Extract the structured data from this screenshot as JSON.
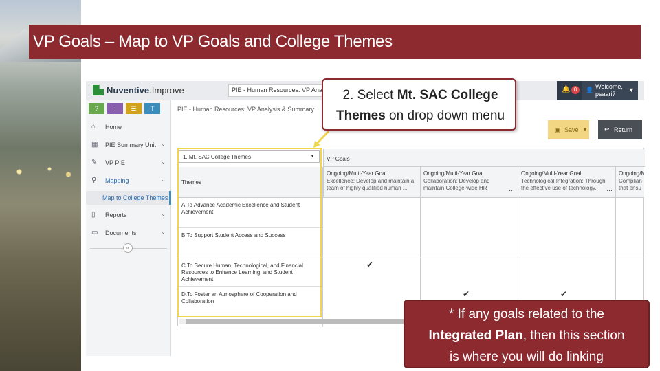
{
  "slide": {
    "title": "VP Goals – Map to VP Goals and College Themes"
  },
  "app": {
    "logo_brand": "Nuventive",
    "logo_suffix": ".Improve",
    "unit_select": "PIE - Human Resources: VP Analy",
    "notification_count": "0",
    "user_welcome": "Welcome,",
    "user_name": "psaari7",
    "breadcrumb": "PIE - Human Resources: VP Analysis & Summary",
    "save_label": "Save",
    "return_label": "Return"
  },
  "sidebar": {
    "items": [
      {
        "label": "Home",
        "icon": "home-icon"
      },
      {
        "label": "PIE Summary Unit",
        "icon": "building-icon"
      },
      {
        "label": "VP PIE",
        "icon": "pencil-icon"
      },
      {
        "label": "Mapping",
        "icon": "sitemap-icon"
      },
      {
        "label": "Reports",
        "icon": "book-icon"
      },
      {
        "label": "Documents",
        "icon": "folder-icon"
      }
    ],
    "subitem": "Map to College Themes"
  },
  "grid": {
    "theme_select": "1. Mt. SAC College Themes",
    "vp_goals_header": "VP Goals",
    "themes_header": "Themes",
    "goals": [
      {
        "title": "Ongoing/Multi-Year Goal",
        "line1": "Excellence: Develop and maintain a",
        "line2": "team of highly qualified human ..."
      },
      {
        "title": "Ongoing/Multi-Year Goal",
        "line1": "Collaboration: Develop and",
        "line2": "maintain College-wide HR"
      },
      {
        "title": "Ongoing/Multi-Year Goal",
        "line1": "Technological Integration: Through",
        "line2": "the effective use of technology,"
      },
      {
        "title": "Ongoing/M",
        "line1": "Complian",
        "line2": "that ensu"
      }
    ],
    "themes": [
      "A.To Advance Academic Excellence and Student Achievement",
      "B.To Support Student Access and Success",
      "C.To Secure Human, Technological, and Financial Resources to Enhance Learning, and Student Achievement",
      "D.To Foster an Atmosphere of Cooperation and Collaboration"
    ],
    "check_glyph": "✔"
  },
  "callouts": {
    "step2_line1_pre": "2. Select ",
    "step2_line1_bold": "Mt. SAC College",
    "step2_line2_bold": "Themes",
    "step2_line2_post": " on drop down menu",
    "note_line1": "* If any goals related to the",
    "note_line2_bold": "Integrated Plan",
    "note_line2_post": ", then this section",
    "note_line3": "is where you will do linking"
  },
  "colors": {
    "accent": "#8c2a2f",
    "highlight": "#f0d64a",
    "save": "#f3d683"
  }
}
